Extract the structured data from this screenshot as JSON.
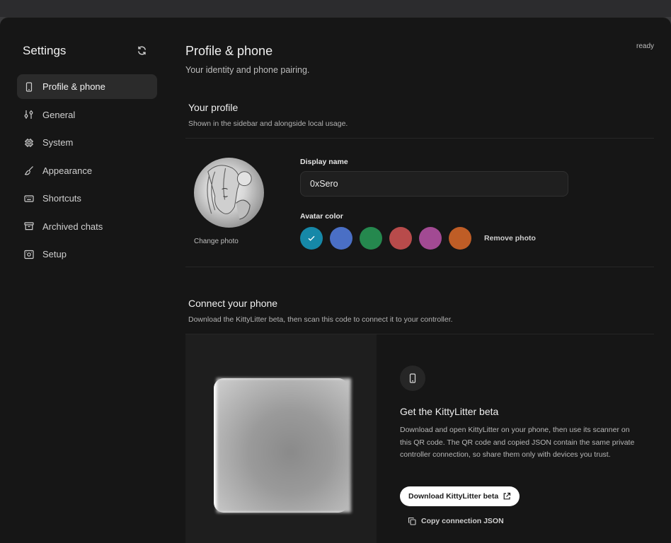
{
  "colors": {
    "window_bg": "#161616",
    "active_nav": "#2b2b2b",
    "swatches": [
      "#1688a8",
      "#4a6fc5",
      "#25884e",
      "#b84b4b",
      "#a24a93",
      "#bf5d26"
    ]
  },
  "sidebar": {
    "title": "Settings",
    "refresh_icon": "refresh-icon",
    "items": [
      {
        "label": "Profile & phone",
        "icon": "phone-icon",
        "active": true
      },
      {
        "label": "General",
        "icon": "sliders-icon"
      },
      {
        "label": "System",
        "icon": "chip-icon"
      },
      {
        "label": "Appearance",
        "icon": "brush-icon"
      },
      {
        "label": "Shortcuts",
        "icon": "keyboard-icon"
      },
      {
        "label": "Archived chats",
        "icon": "archive-icon"
      },
      {
        "label": "Setup",
        "icon": "setup-icon"
      }
    ]
  },
  "header": {
    "title": "Profile & phone",
    "subtitle": "Your identity and phone pairing.",
    "status": "ready"
  },
  "profile": {
    "title": "Your profile",
    "subtitle": "Shown in the sidebar and alongside local usage.",
    "change_photo": "Change photo",
    "display_name_label": "Display name",
    "display_name_value": "0xSero",
    "avatar_color_label": "Avatar color",
    "selected_swatch": 0,
    "remove_photo": "Remove photo"
  },
  "phone": {
    "title": "Connect your phone",
    "subtitle": "Download the KittyLitter beta, then scan this code to connect it to your controller.",
    "info_title": "Get the KittyLitter beta",
    "info_body": "Download and open KittyLitter on your phone, then use its scanner on this QR code. The QR code and copied JSON contain the same private controller connection, so share them only with devices you trust.",
    "download_label": "Download KittyLitter beta",
    "copy_label": "Copy connection JSON"
  }
}
